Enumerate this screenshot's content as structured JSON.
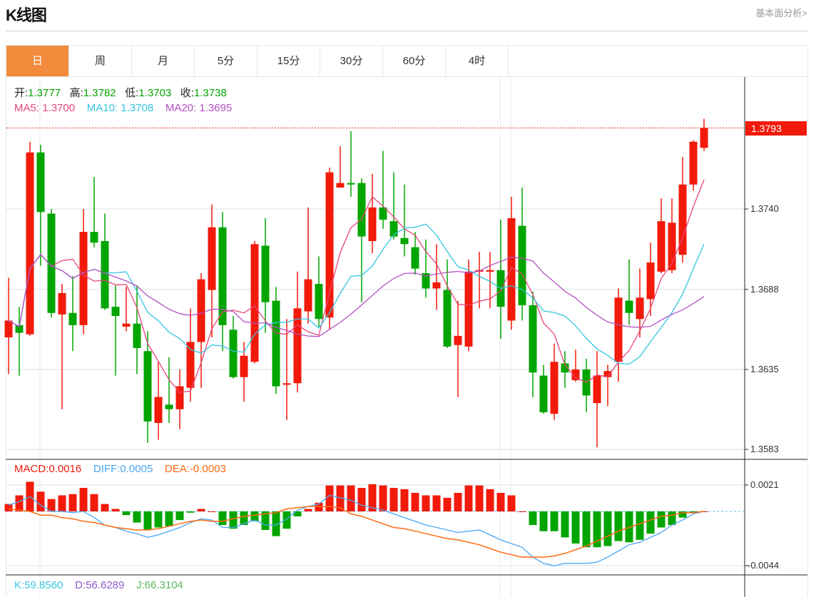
{
  "header": {
    "title": "K线图",
    "link": "基本面分析>"
  },
  "tabs": [
    {
      "label": "日",
      "active": true
    },
    {
      "label": "周"
    },
    {
      "label": "月"
    },
    {
      "label": "5分"
    },
    {
      "label": "15分"
    },
    {
      "label": "30分"
    },
    {
      "label": "60分"
    },
    {
      "label": "4时"
    }
  ],
  "ohlc_legend": {
    "open_label": "开:",
    "open": "1.3777",
    "high_label": "高:",
    "high": "1.3782",
    "low_label": "低:",
    "low": "1.3703",
    "close_label": "收:",
    "close": "1.3738"
  },
  "ma_legend": {
    "ma5_label": "MA5:",
    "ma5": "1.3700",
    "ma10_label": "MA10:",
    "ma10": "1.3708",
    "ma20_label": "MA20:",
    "ma20": "1.3695"
  },
  "macd_legend": {
    "macd_label": "MACD:",
    "macd": "0.0016",
    "diff_label": "DIFF:",
    "diff": "0.0005",
    "dea_label": "DEA:",
    "dea": "-0.0003"
  },
  "kdj_legend": {
    "k_label": "K:",
    "k": "59.8560",
    "d_label": "D:",
    "d": "56.6289",
    "j_label": "J:",
    "j": "66.3104"
  },
  "last_price": "1.3793",
  "colors": {
    "up": "#f21a0a",
    "down": "#03a500",
    "accent": "#f28c3c",
    "ma5": "#e8457c",
    "ma10": "#35c5e0",
    "ma20": "#b450c4",
    "diff": "#4aa7f5",
    "dea": "#ff6a10",
    "k": "#35c5e0",
    "d": "#8a5cc8",
    "j": "#5bb85b"
  },
  "chart_data": [
    {
      "type": "candlestick",
      "title": "K线图 (日)",
      "ylim": [
        1.3583,
        1.38
      ],
      "y_ticks": [
        "1.3740",
        "1.3688",
        "1.3635",
        "1.3583"
      ],
      "grid": true,
      "ohlc": [
        [
          1.3656,
          1.3695,
          1.3632,
          1.3667
        ],
        [
          1.3664,
          1.3676,
          1.3631,
          1.3659
        ],
        [
          1.3658,
          1.3784,
          1.3657,
          1.3777
        ],
        [
          1.3777,
          1.3782,
          1.3703,
          1.3738
        ],
        [
          1.3737,
          1.374,
          1.3669,
          1.3672
        ],
        [
          1.3671,
          1.3691,
          1.3609,
          1.3685
        ],
        [
          1.3672,
          1.3696,
          1.3647,
          1.3664
        ],
        [
          1.3664,
          1.374,
          1.3658,
          1.3725
        ],
        [
          1.3725,
          1.3761,
          1.3715,
          1.3718
        ],
        [
          1.3719,
          1.3737,
          1.3674,
          1.3675
        ],
        [
          1.3676,
          1.369,
          1.3631,
          1.367
        ],
        [
          1.3663,
          1.3689,
          1.366,
          1.3665
        ],
        [
          1.3665,
          1.369,
          1.3632,
          1.3649
        ],
        [
          1.3647,
          1.366,
          1.3587,
          1.3601
        ],
        [
          1.36,
          1.364,
          1.3589,
          1.3617
        ],
        [
          1.3612,
          1.3643,
          1.36,
          1.3609
        ],
        [
          1.3609,
          1.3635,
          1.3596,
          1.3624
        ],
        [
          1.3623,
          1.3675,
          1.3614,
          1.3653
        ],
        [
          1.3653,
          1.3698,
          1.3623,
          1.3694
        ],
        [
          1.3687,
          1.3743,
          1.3656,
          1.3728
        ],
        [
          1.3728,
          1.3738,
          1.3647,
          1.3664
        ],
        [
          1.3661,
          1.367,
          1.3629,
          1.363
        ],
        [
          1.363,
          1.3653,
          1.3614,
          1.3644
        ],
        [
          1.364,
          1.3719,
          1.3639,
          1.3717
        ],
        [
          1.3716,
          1.3734,
          1.3659,
          1.3679
        ],
        [
          1.368,
          1.3689,
          1.3619,
          1.3624
        ],
        [
          1.3625,
          1.3668,
          1.3602,
          1.3626
        ],
        [
          1.3626,
          1.3699,
          1.362,
          1.3675
        ],
        [
          1.3673,
          1.3741,
          1.3665,
          1.3694
        ],
        [
          1.3691,
          1.3709,
          1.3663,
          1.3668
        ],
        [
          1.3669,
          1.3767,
          1.3661,
          1.3764
        ],
        [
          1.3754,
          1.3781,
          1.3754,
          1.3757
        ],
        [
          1.3757,
          1.3791,
          1.3748,
          1.3756
        ],
        [
          1.3757,
          1.376,
          1.3679,
          1.3722
        ],
        [
          1.3719,
          1.3763,
          1.3711,
          1.3741
        ],
        [
          1.3741,
          1.3778,
          1.3727,
          1.3733
        ],
        [
          1.3732,
          1.3764,
          1.372,
          1.3722
        ],
        [
          1.3721,
          1.3756,
          1.3709,
          1.3717
        ],
        [
          1.3715,
          1.3725,
          1.3697,
          1.3701
        ],
        [
          1.3698,
          1.372,
          1.3682,
          1.3688
        ],
        [
          1.3688,
          1.3717,
          1.3674,
          1.3692
        ],
        [
          1.3687,
          1.3707,
          1.3649,
          1.365
        ],
        [
          1.3651,
          1.368,
          1.3617,
          1.3657
        ],
        [
          1.365,
          1.3707,
          1.3647,
          1.3699
        ],
        [
          1.3699,
          1.3712,
          1.3675,
          1.37
        ],
        [
          1.3699,
          1.3712,
          1.3675,
          1.37
        ],
        [
          1.37,
          1.3733,
          1.3655,
          1.3676
        ],
        [
          1.3667,
          1.3748,
          1.3661,
          1.3734
        ],
        [
          1.3729,
          1.3754,
          1.3667,
          1.3677
        ],
        [
          1.3677,
          1.3686,
          1.3617,
          1.3633
        ],
        [
          1.3631,
          1.3638,
          1.3606,
          1.3607
        ],
        [
          1.3606,
          1.3652,
          1.3602,
          1.364
        ],
        [
          1.3639,
          1.3647,
          1.3623,
          1.3633
        ],
        [
          1.3628,
          1.3648,
          1.3627,
          1.3635
        ],
        [
          1.3635,
          1.3642,
          1.3607,
          1.3618
        ],
        [
          1.3613,
          1.3647,
          1.3584,
          1.3631
        ],
        [
          1.363,
          1.3638,
          1.3611,
          1.3634
        ],
        [
          1.364,
          1.3688,
          1.3627,
          1.3682
        ],
        [
          1.368,
          1.3707,
          1.3664,
          1.3672
        ],
        [
          1.3668,
          1.3701,
          1.3656,
          1.3682
        ],
        [
          1.3681,
          1.3718,
          1.367,
          1.3705
        ],
        [
          1.3699,
          1.3747,
          1.3698,
          1.3732
        ],
        [
          1.37,
          1.3747,
          1.3698,
          1.3731
        ],
        [
          1.371,
          1.3774,
          1.3705,
          1.3756
        ],
        [
          1.3756,
          1.3785,
          1.3752,
          1.3784
        ],
        [
          1.378,
          1.3799,
          1.3778,
          1.3793
        ]
      ],
      "series": [
        {
          "name": "MA5",
          "period": 5
        },
        {
          "name": "MA10",
          "period": 10
        },
        {
          "name": "MA20",
          "period": 20
        }
      ],
      "last_price": 1.3793
    },
    {
      "type": "bar+line",
      "title": "MACD",
      "ylim": [
        -0.0044,
        0.0021
      ],
      "y_ticks": [
        "0.0021",
        "-0.0044"
      ],
      "macd": [
        0.0006,
        0.0013,
        0.0024,
        0.0016,
        0.001,
        0.0013,
        0.0014,
        0.0019,
        0.0014,
        0.0006,
        0.0002,
        -0.0003,
        -0.0009,
        -0.0015,
        -0.0013,
        -0.0012,
        -0.0007,
        -0.0001,
        0.0002,
        0.0,
        -0.0011,
        -0.0014,
        -0.0011,
        -0.0008,
        -0.0015,
        -0.002,
        -0.0014,
        -0.0004,
        0.0002,
        0.0007,
        0.0021,
        0.0021,
        0.0021,
        0.0019,
        0.0022,
        0.0021,
        0.0019,
        0.0018,
        0.0015,
        0.0013,
        0.0013,
        0.0011,
        0.0015,
        0.0021,
        0.0021,
        0.0018,
        0.0015,
        0.0013,
        0.0,
        -0.0011,
        -0.0016,
        -0.0016,
        -0.0021,
        -0.0026,
        -0.0029,
        -0.0029,
        -0.0028,
        -0.0024,
        -0.0025,
        -0.0023,
        -0.0018,
        -0.0013,
        -0.0011,
        -0.0005,
        -0.0001,
        0.0
      ],
      "diff": [
        0.0005,
        0.0008,
        0.0012,
        0.0005,
        0.0,
        0.0,
        -0.0001,
        0.0,
        -0.0005,
        -0.0011,
        -0.0013,
        -0.0016,
        -0.0018,
        -0.0021,
        -0.0019,
        -0.0016,
        -0.0013,
        -0.0009,
        -0.0006,
        -0.0007,
        -0.0013,
        -0.0013,
        -0.001,
        -0.0007,
        -0.0011,
        -0.0011,
        -0.0006,
        0.0001,
        0.0004,
        0.0006,
        0.0013,
        0.0011,
        0.0009,
        0.0005,
        0.0003,
        0.0001,
        -0.0002,
        -0.0005,
        -0.0008,
        -0.0011,
        -0.0013,
        -0.0015,
        -0.0017,
        -0.0016,
        -0.0015,
        -0.0019,
        -0.0023,
        -0.0026,
        -0.0029,
        -0.0037,
        -0.0042,
        -0.0044,
        -0.0042,
        -0.0042,
        -0.0042,
        -0.0041,
        -0.0037,
        -0.0032,
        -0.0027,
        -0.0025,
        -0.0021,
        -0.0017,
        -0.0011,
        -0.0007,
        -0.0002,
        0.0
      ],
      "dea": [
        0.0002,
        0.0001,
        0.0,
        -0.0003,
        -0.0003,
        -0.0005,
        -0.0006,
        -0.0008,
        -0.0009,
        -0.0011,
        -0.0013,
        -0.0014,
        -0.0015,
        -0.0015,
        -0.0014,
        -0.0012,
        -0.001,
        -0.0008,
        -0.0007,
        -0.0008,
        -0.0008,
        -0.0006,
        -0.0004,
        -0.0003,
        -0.0002,
        -0.0001,
        0.0002,
        0.0003,
        0.0004,
        0.0004,
        0.0004,
        0.0003,
        -0.0002,
        -0.0004,
        -0.0007,
        -0.001,
        -0.0013,
        -0.0014,
        -0.0016,
        -0.0018,
        -0.002,
        -0.0022,
        -0.0023,
        -0.0025,
        -0.0027,
        -0.003,
        -0.0033,
        -0.0035,
        -0.0037,
        -0.0037,
        -0.0037,
        -0.0036,
        -0.0034,
        -0.0031,
        -0.0028,
        -0.0024,
        -0.002,
        -0.0016,
        -0.0013,
        -0.001,
        -0.0007,
        -0.0004,
        -0.0003,
        -0.0001,
        -0.0001,
        0.0
      ]
    }
  ]
}
